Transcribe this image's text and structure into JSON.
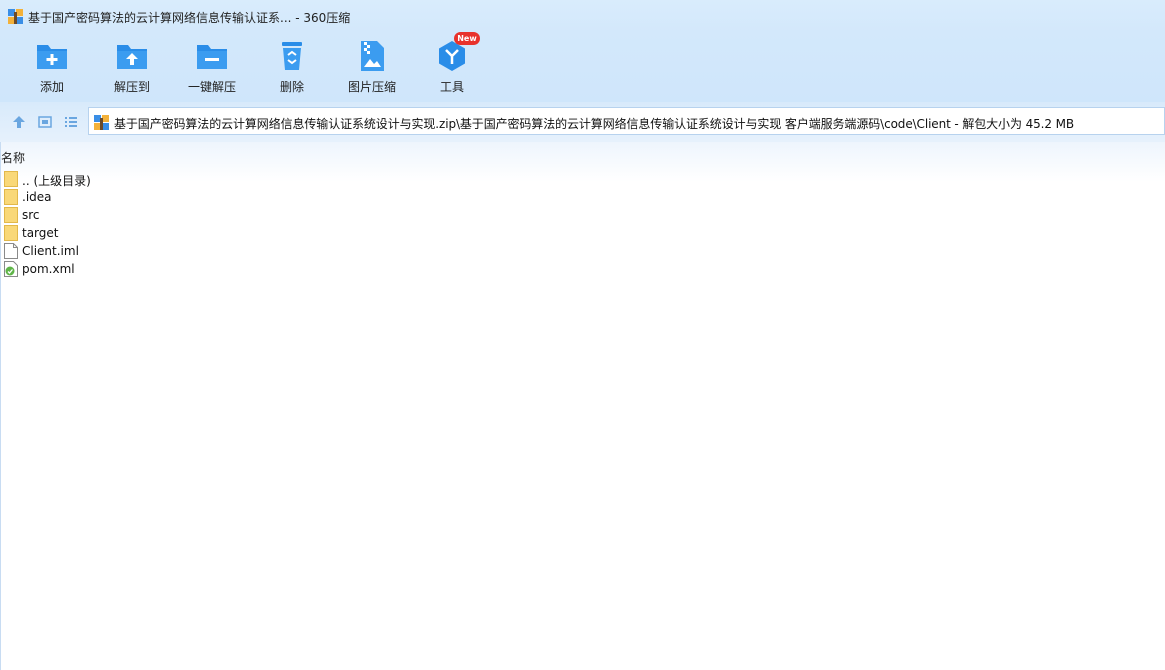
{
  "window": {
    "title": "基于国产密码算法的云计算网络信息传输认证系... - 360压缩"
  },
  "toolbar": {
    "items": [
      {
        "label": "添加",
        "icon": "folder-add-icon"
      },
      {
        "label": "解压到",
        "icon": "folder-extract-icon"
      },
      {
        "label": "一键解压",
        "icon": "folder-quick-extract-icon"
      },
      {
        "label": "删除",
        "icon": "recycle-bin-icon"
      },
      {
        "label": "图片压缩",
        "icon": "image-compress-icon"
      },
      {
        "label": "工具",
        "icon": "tools-cube-icon"
      }
    ],
    "tools_badge": "New"
  },
  "address": {
    "path": "基于国产密码算法的云计算网络信息传输认证系统设计与实现.zip\\基于国产密码算法的云计算网络信息传输认证系统设计与实现 客户端服务端源码\\code\\Client - 解包大小为 45.2 MB"
  },
  "filelist": {
    "column_name": "名称",
    "items": [
      {
        "name": ".. (上级目录)",
        "type": "folder"
      },
      {
        "name": ".idea",
        "type": "folder"
      },
      {
        "name": "src",
        "type": "folder"
      },
      {
        "name": "target",
        "type": "folder"
      },
      {
        "name": "Client.iml",
        "type": "file"
      },
      {
        "name": "pom.xml",
        "type": "xml"
      }
    ]
  },
  "colors": {
    "accent": "#2a8de8",
    "toolbar_bg": "#d3e8fb",
    "badge": "#e8322c",
    "folder": "#f9d878"
  }
}
